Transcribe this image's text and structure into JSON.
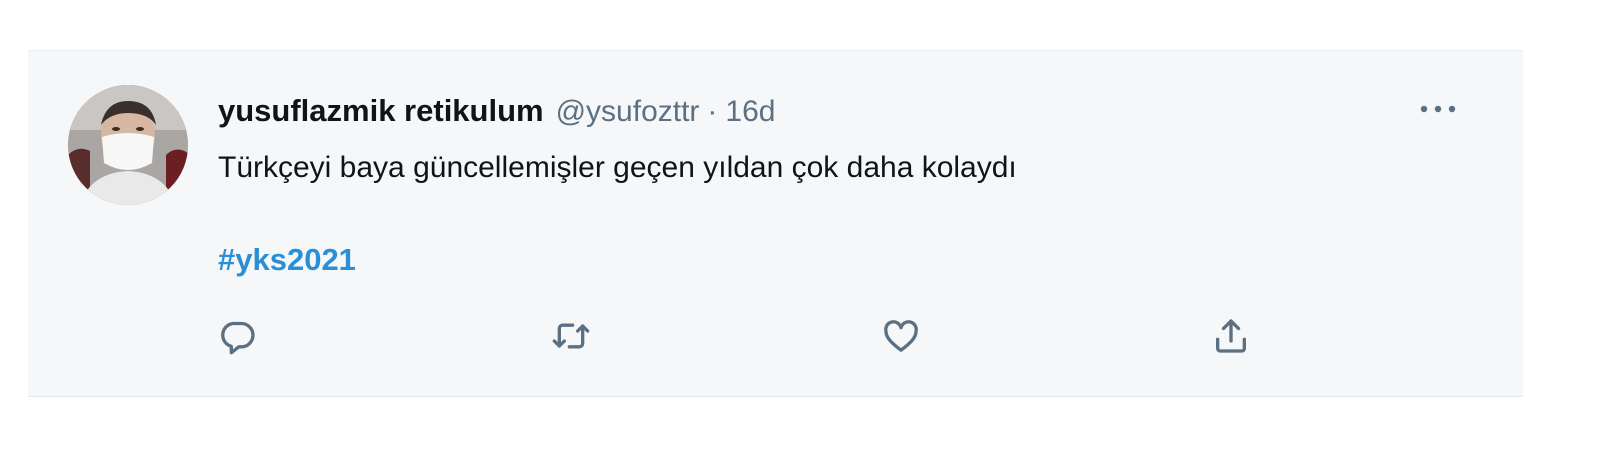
{
  "tweet": {
    "display_name": "yusuflazmik retikulum",
    "handle": "@ysufozttr",
    "separator": "·",
    "time": "16d",
    "text": "Türkçeyi baya güncellemişler geçen yıldan çok daha kolaydı",
    "hashtag": "#yks2021"
  },
  "icons": {
    "more": "more-dots-icon",
    "reply": "reply-icon",
    "retweet": "retweet-icon",
    "like": "heart-icon",
    "share": "share-icon"
  },
  "colors": {
    "card_background": "#f5f7f8",
    "text_primary": "#0f1419",
    "text_secondary": "#5b7083",
    "hashtag": "#2a8fd6"
  }
}
